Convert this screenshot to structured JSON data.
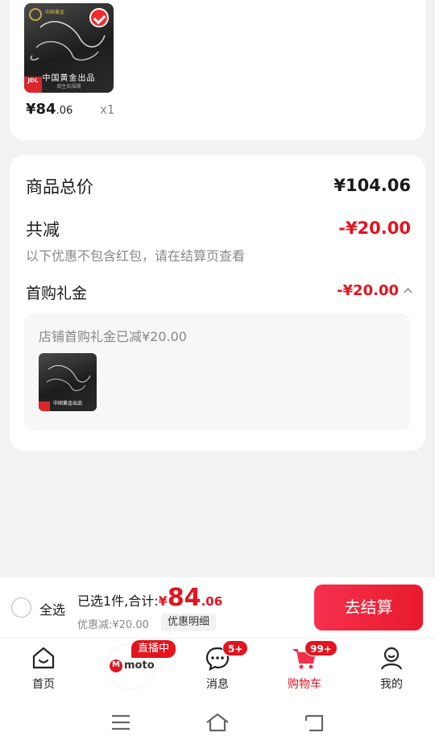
{
  "product": {
    "brand_text": "中国黄金",
    "caption": "中国黄金出品",
    "caption_sub": "周生如福珊",
    "jd_badge": "JDL",
    "price_symbol": "¥",
    "price_int": "84",
    "price_dec": ".06",
    "qty": "x1"
  },
  "summary": {
    "total_label": "商品总价",
    "total_value": "¥104.06",
    "reduce_label": "共减",
    "reduce_value": "-¥20.00",
    "reduce_note": "以下优惠不包含红包，请在结算页查看",
    "gift_label": "首购礼金",
    "gift_value": "-¥20.00",
    "coupon_text": "店铺首购礼金已减¥20.00",
    "coupon_img_caption": "中国黄金出品"
  },
  "checkout": {
    "select_all": "全选",
    "selected_text": "已选1件,合计:",
    "total_symbol": "¥",
    "total_int": "84",
    "total_dec": ".06",
    "discount_text": "优惠减:¥20.00",
    "detail_btn": "优惠明细",
    "go_btn": "去结算"
  },
  "tabbar": {
    "home": "首页",
    "live_badge": "直播中",
    "moto": "moto",
    "messages": "消息",
    "messages_badge": "5+",
    "cart": "购物车",
    "cart_badge": "99+",
    "mine": "我的"
  },
  "colors": {
    "accent_red": "#e3141e",
    "checkout_btn": "#f0233a"
  },
  "icons": [
    "check-icon",
    "chevron-up-icon",
    "home-icon",
    "chat-icon",
    "cart-icon",
    "user-icon",
    "menu-icon",
    "home-nav-icon",
    "back-icon"
  ]
}
